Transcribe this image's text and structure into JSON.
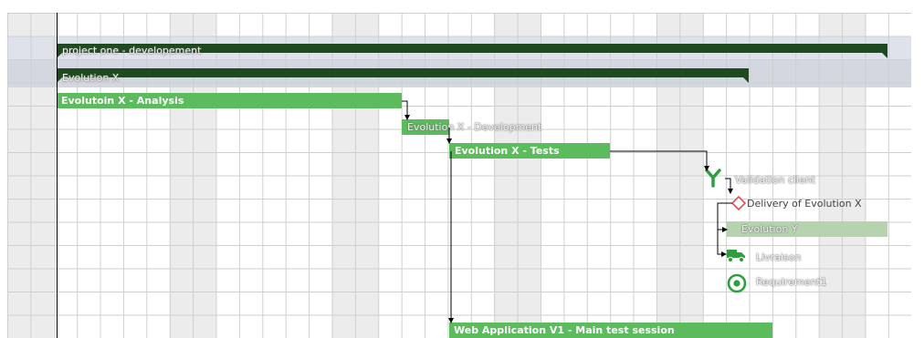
{
  "tasks": {
    "project": "project one - developement",
    "evolution_x": "Evolution X",
    "analysis": "Evolutoin X - Analysis",
    "development": "Evolution X - Development",
    "tests": "Evolution X - Tests",
    "validation": "Validation client",
    "delivery": "Delivery of Evolution X",
    "evolution_y": "Evolution Y",
    "livraison": "Livraison",
    "requirement": "Requirement1",
    "web_app": "Web Application V1 - Main test session"
  },
  "icons": {
    "validation": "fork-y-icon",
    "delivery": "diamond-milestone-icon",
    "livraison": "delivery-truck-icon",
    "requirement": "target-icon"
  },
  "colors": {
    "summary_bar": "#1f4a1f",
    "task_bar": "#5cbb5c",
    "pending_bar": "#b6d3b0",
    "milestone": "#d9534f",
    "icon_green": "#2e9e3e"
  }
}
